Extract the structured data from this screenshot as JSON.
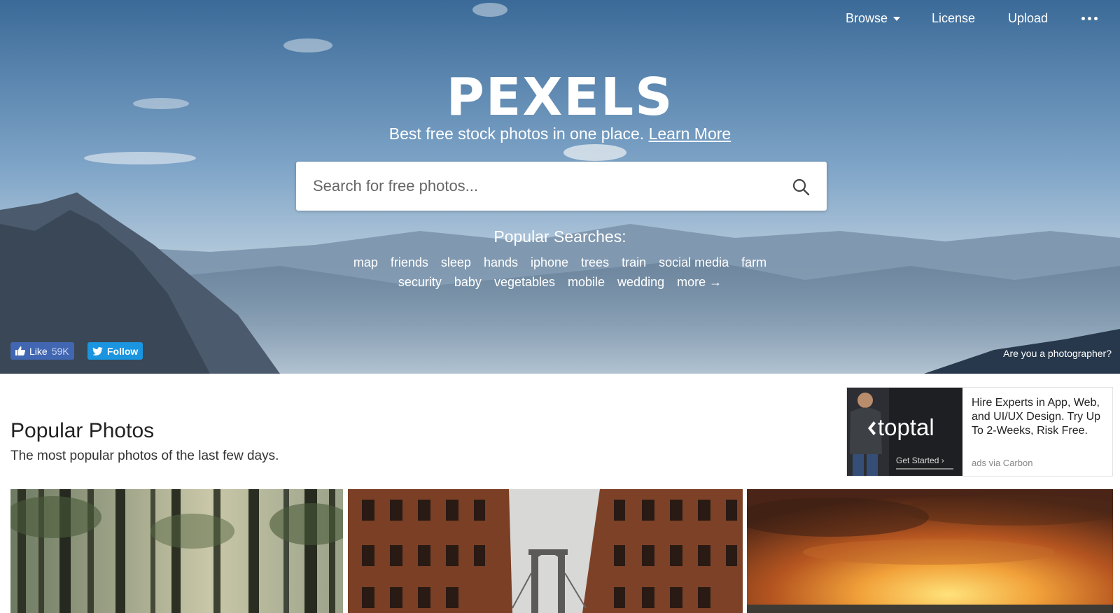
{
  "nav": {
    "browse": "Browse",
    "license": "License",
    "upload": "Upload",
    "more_icon": "more-dots-icon"
  },
  "hero": {
    "logo": "PEXELS",
    "tagline": "Best free stock photos in one place.",
    "learn_more": "Learn More",
    "search_placeholder": "Search for free photos...",
    "search_icon": "search-icon",
    "popular_title": "Popular Searches:",
    "tags_row1": [
      "map",
      "friends",
      "sleep",
      "hands",
      "iphone",
      "trees",
      "train",
      "social media",
      "farm"
    ],
    "tags_row2": [
      "security",
      "baby",
      "vegetables",
      "mobile",
      "wedding",
      "more →"
    ],
    "fb_like": "Like",
    "fb_count": "59K",
    "tw_follow": "Follow",
    "photographer": "Are you a photographer?"
  },
  "main": {
    "title": "Popular Photos",
    "subtitle": "The most popular photos of the last few days."
  },
  "ad": {
    "brand": "toptal",
    "cta": "Get Started ›",
    "text": "Hire Experts in App, Web, and UI/UX Design. Try Up To 2-Weeks, Risk Free.",
    "via": "ads via Carbon"
  },
  "photos": [
    {
      "subject": "forest"
    },
    {
      "subject": "brick buildings and bridge"
    },
    {
      "subject": "sunset sky"
    }
  ],
  "colors": {
    "facebook": "#4267b2",
    "twitter": "#1b95e0"
  }
}
